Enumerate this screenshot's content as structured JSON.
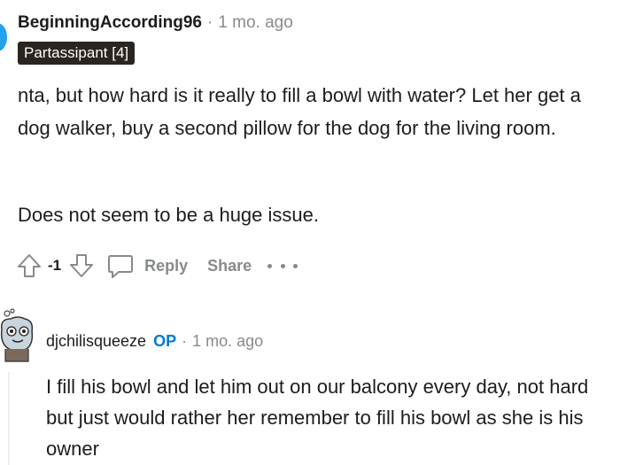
{
  "comment1": {
    "username": "BeginningAccording96",
    "separator": "·",
    "timestamp": "1 mo. ago",
    "flair": "Partassipant [4]",
    "paragraphs": [
      "nta, but how hard is it really to fill a bowl with water? Let her get a dog walker, buy a second pillow for the dog for the living room.",
      "Does not seem to be a huge issue."
    ],
    "score": "-1",
    "reply_label": "Reply",
    "share_label": "Share"
  },
  "comment2": {
    "username": "djchilisqueeze",
    "op_badge": "OP",
    "separator": "·",
    "timestamp": "1 mo. ago",
    "paragraphs": [
      "I fill his bowl and let him out on our balcony every day, not hard but just would rather her remember to fill his bowl as she is his owner"
    ]
  },
  "colors": {
    "text": "#1c1c1c",
    "meta": "#878a8c",
    "flair_bg": "#2b2420",
    "op": "#0079d3",
    "avatar_blue": "#24a0ed"
  },
  "icons": [
    "upvote-icon",
    "downvote-icon",
    "comment-icon",
    "more-options-icon",
    "avatar-icon"
  ]
}
